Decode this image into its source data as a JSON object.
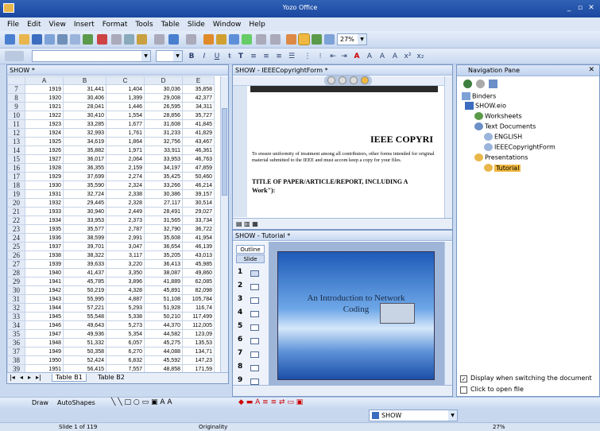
{
  "app": {
    "title": "Yozo Office"
  },
  "menu": [
    "File",
    "Edit",
    "View",
    "Insert",
    "Format",
    "Tools",
    "Table",
    "Slide",
    "Window",
    "Help"
  ],
  "toolbar": {
    "zoom": "27%"
  },
  "sheet": {
    "title": "SHOW *",
    "columns": [
      "A",
      "B",
      "C",
      "D",
      "E"
    ],
    "rows": [
      {
        "n": "7",
        "a": "1919",
        "b": "31,441",
        "c": "1,404",
        "d": "30,036",
        "e": "35,858"
      },
      {
        "n": "8",
        "a": "1920",
        "b": "30,406",
        "c": "1,399",
        "d": "29,008",
        "e": "42,377"
      },
      {
        "n": "9",
        "a": "1921",
        "b": "28,041",
        "c": "1,446",
        "d": "26,595",
        "e": "34,311"
      },
      {
        "n": "10",
        "a": "1922",
        "b": "30,410",
        "c": "1,554",
        "d": "28,856",
        "e": "35,727"
      },
      {
        "n": "11",
        "a": "1923",
        "b": "33,285",
        "c": "1,677",
        "d": "31,608",
        "e": "41,845"
      },
      {
        "n": "12",
        "a": "1924",
        "b": "32,993",
        "c": "1,761",
        "d": "31,233",
        "e": "41,829"
      },
      {
        "n": "13",
        "a": "1925",
        "b": "34,619",
        "c": "1,864",
        "d": "32,756",
        "e": "43,467"
      },
      {
        "n": "14",
        "a": "1926",
        "b": "35,882",
        "c": "1,971",
        "d": "33,911",
        "e": "46,361"
      },
      {
        "n": "15",
        "a": "1927",
        "b": "36,017",
        "c": "2,064",
        "d": "33,953",
        "e": "46,763"
      },
      {
        "n": "16",
        "a": "1928",
        "b": "36,355",
        "c": "2,159",
        "d": "34,197",
        "e": "47,859"
      },
      {
        "n": "17",
        "a": "1929",
        "b": "37,699",
        "c": "2,274",
        "d": "35,425",
        "e": "50,460"
      },
      {
        "n": "18",
        "a": "1930",
        "b": "35,590",
        "c": "2,324",
        "d": "33,266",
        "e": "46,214"
      },
      {
        "n": "19",
        "a": "1931",
        "b": "32,724",
        "c": "2,338",
        "d": "30,386",
        "e": "39,157"
      },
      {
        "n": "20",
        "a": "1932",
        "b": "29,445",
        "c": "2,328",
        "d": "27,117",
        "e": "30,514"
      },
      {
        "n": "21",
        "a": "1933",
        "b": "30,940",
        "c": "2,449",
        "d": "28,491",
        "e": "29,027"
      },
      {
        "n": "22",
        "a": "1934",
        "b": "33,953",
        "c": "2,373",
        "d": "31,565",
        "e": "33,734"
      },
      {
        "n": "23",
        "a": "1935",
        "b": "35,577",
        "c": "2,787",
        "d": "32,790",
        "e": "36,722"
      },
      {
        "n": "24",
        "a": "1936",
        "b": "38,599",
        "c": "2,991",
        "d": "35,608",
        "e": "41,954"
      },
      {
        "n": "25",
        "a": "1937",
        "b": "39,701",
        "c": "3,047",
        "d": "36,654",
        "e": "46,139"
      },
      {
        "n": "26",
        "a": "1938",
        "b": "38,322",
        "c": "3,117",
        "d": "35,205",
        "e": "43,013"
      },
      {
        "n": "27",
        "a": "1939",
        "b": "39,633",
        "c": "3,220",
        "d": "36,413",
        "e": "45,985"
      },
      {
        "n": "28",
        "a": "1940",
        "b": "41,437",
        "c": "3,350",
        "d": "38,087",
        "e": "49,860"
      },
      {
        "n": "29",
        "a": "1941",
        "b": "45,785",
        "c": "3,896",
        "d": "41,889",
        "e": "62,085"
      },
      {
        "n": "30",
        "a": "1942",
        "b": "50,219",
        "c": "4,328",
        "d": "45,891",
        "e": "82,098"
      },
      {
        "n": "31",
        "a": "1943",
        "b": "55,995",
        "c": "4,887",
        "d": "51,108",
        "e": "105,784"
      },
      {
        "n": "32",
        "a": "1944",
        "b": "57,221",
        "c": "5,293",
        "d": "51,928",
        "e": "116,74"
      },
      {
        "n": "33",
        "a": "1945",
        "b": "55,548",
        "c": "5,338",
        "d": "50,210",
        "e": "117,499"
      },
      {
        "n": "34",
        "a": "1946",
        "b": "49,643",
        "c": "5,273",
        "d": "44,370",
        "e": "112,005"
      },
      {
        "n": "35",
        "a": "1947",
        "b": "49,936",
        "c": "5,354",
        "d": "44,582",
        "e": "123,09"
      },
      {
        "n": "36",
        "a": "1948",
        "b": "51,332",
        "c": "6,057",
        "d": "45,275",
        "e": "135,53"
      },
      {
        "n": "37",
        "a": "1949",
        "b": "50,358",
        "c": "6,270",
        "d": "44,088",
        "e": "134,71"
      },
      {
        "n": "38",
        "a": "1950",
        "b": "52,424",
        "c": "6,832",
        "d": "45,592",
        "e": "147,23"
      },
      {
        "n": "39",
        "a": "1951",
        "b": "56,415",
        "c": "7,557",
        "d": "48,858",
        "e": "171,59"
      },
      {
        "n": "40",
        "a": "1952",
        "b": "57,702",
        "c": "7,739",
        "d": "49,963",
        "e": "185,81"
      }
    ],
    "tabs": [
      "Table B1",
      "Table B2"
    ]
  },
  "doc": {
    "title": "SHOW - IEEECopyrightForm *",
    "heading": "IEEE COPYRI",
    "para": "To ensure uniformity of treatment among all contributors, other forms intended for original material submitted to the IEEE and must accom keep a copy for your files.",
    "title_line": "TITLE OF PAPER/ARTICLE/REPORT, INCLUDING A",
    "title_line2": "Work\"):"
  },
  "pres": {
    "title": "SHOW - Tutorial *",
    "tab_outline": "Outline",
    "tab_slide": "Slide",
    "slide_numbers": [
      "1",
      "2",
      "3",
      "4",
      "5",
      "6",
      "7",
      "8",
      "9"
    ],
    "slide_title": "An Introduction to Network",
    "slide_sub": "Coding"
  },
  "nav": {
    "title": "Navigation Pane",
    "binders": "Binders",
    "file": "SHOW.eio",
    "worksheets": "Worksheets",
    "textdocs": "Text Documents",
    "english": "ENGLISH",
    "ieee": "IEEECopyrightForm",
    "presentations": "Presentations",
    "tutorial": "Tutorial",
    "opt1": "Display when switching the document",
    "opt2": "Click to open file"
  },
  "draw": {
    "draw": "Draw",
    "autoshapes": "AutoShapes"
  },
  "showcombo": "SHOW",
  "status": {
    "slide": "Slide 1 of 119",
    "design": "Originality",
    "zoom": "27%"
  },
  "colors": {
    "accent": "#f0b840",
    "title": "#1b47a0"
  }
}
